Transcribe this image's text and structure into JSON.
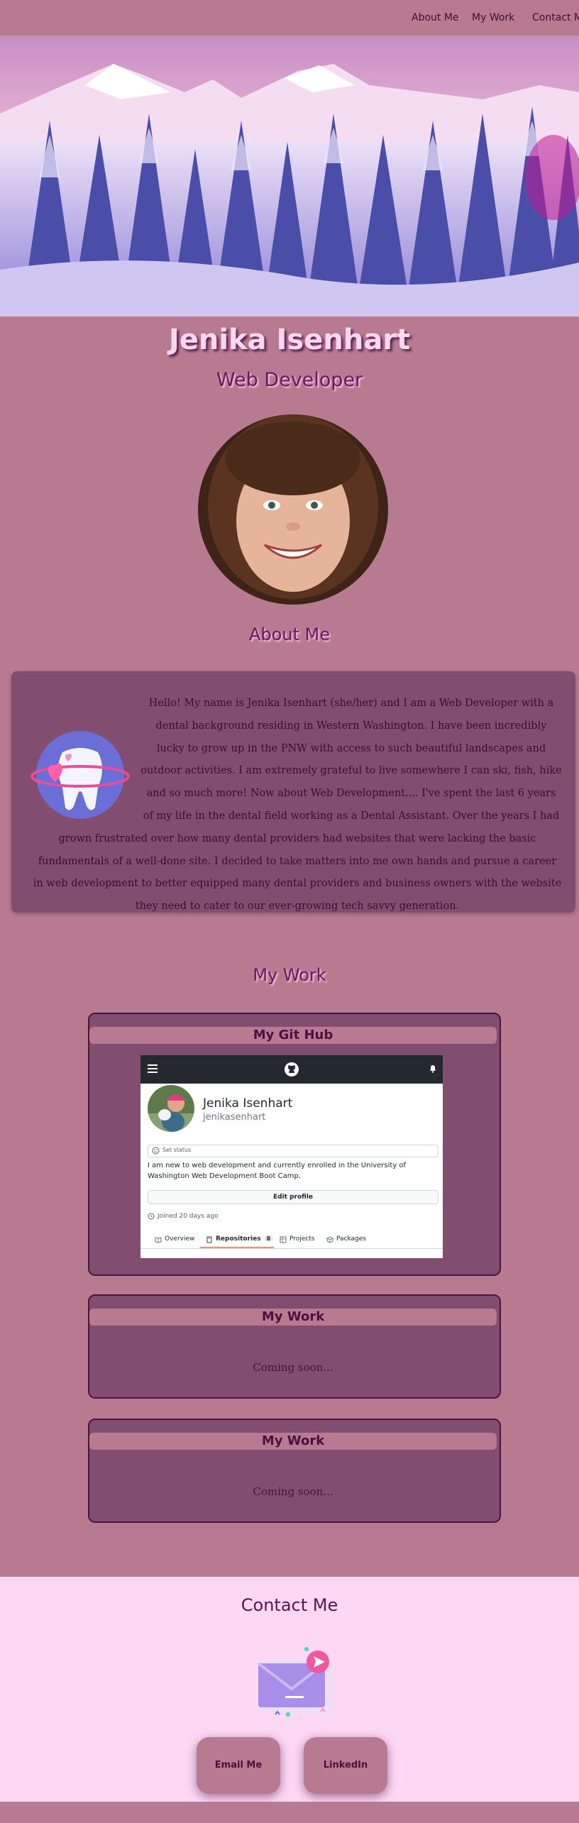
{
  "nav": {
    "items": [
      "About Me",
      "My Work",
      "Contact Me"
    ]
  },
  "header": {
    "name": "Jenika Isenhart",
    "role": "Web Developer"
  },
  "about": {
    "heading": "About Me",
    "text": "Hello! My name is Jenika Isenhart (she/her) and I am a Web Developer with a dental background residing in Western Washington. I have been incredibly lucky to grow up in the PNW with access to such beautiful landscapes and outdoor activities. I am extremely grateful to live somewhere I can ski, fish, hike and so much more! Now about Web Development.... I've spent the last 6 years of my life in the dental field working as a Dental Assistant. Over the years I had grown frustrated over how many dental providers had websites that were lacking the basic fundamentals of a well-done site. I decided to take matters into me own hands and pursue a career in web development to better equipped many dental providers and business owners with the website they need to cater to our ever-growing tech savvy generation."
  },
  "work": {
    "heading": "My Work",
    "cards": [
      {
        "title": "My Git Hub"
      },
      {
        "title": "My Work",
        "text": "Coming soon..."
      },
      {
        "title": "My Work",
        "text": "Coming soon..."
      }
    ],
    "github": {
      "name": "Jenika Isenhart",
      "username": "jenikasenhart",
      "set_status": "Set status",
      "bio": "I am new to web development and currently enrolled in the University of Washington Web Development Boot Camp.",
      "edit_profile": "Edit profile",
      "joined": "Joined 20 days ago",
      "tabs": [
        {
          "label": "Overview"
        },
        {
          "label": "Repositories",
          "count": "8"
        },
        {
          "label": "Projects"
        },
        {
          "label": "Packages"
        }
      ]
    }
  },
  "contact": {
    "heading": "Contact Me",
    "buttons": [
      "Email Me",
      "LinkedIn"
    ]
  },
  "colors": {
    "page": "#b87a90",
    "card": "#824e70",
    "contact_bg": "#fcd8f3",
    "heading": "#6b1a5c",
    "name": "#fcd8f0"
  },
  "icons": [
    "menu-icon",
    "github-logo-icon",
    "bell-icon",
    "smiley-icon",
    "clock-icon",
    "book-icon",
    "repo-icon",
    "project-icon",
    "package-icon",
    "envelope-icon",
    "tooth-heart-icon"
  ]
}
